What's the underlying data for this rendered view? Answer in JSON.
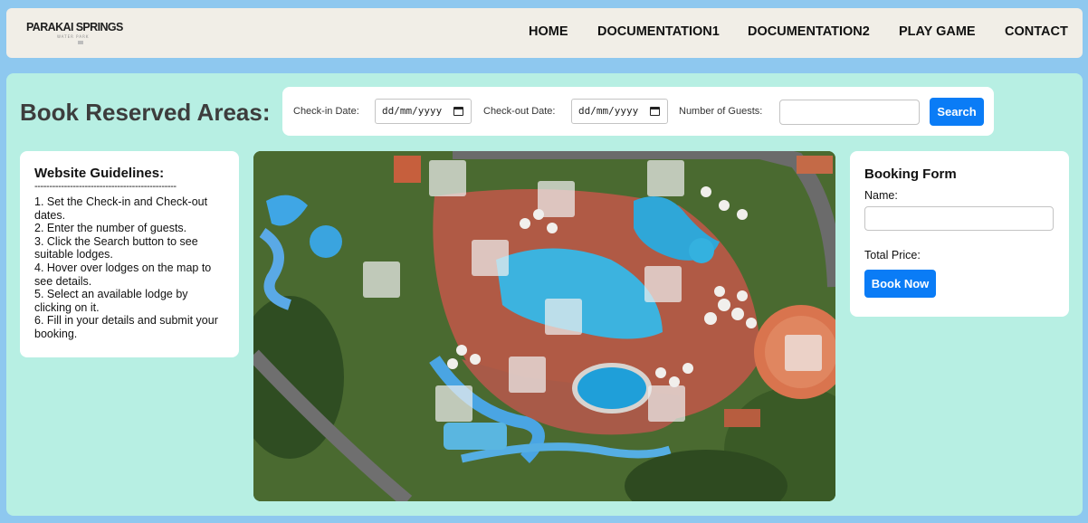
{
  "header": {
    "logo": {
      "name": "PARAKAI SPRINGS",
      "tagline": "WATER PARK"
    },
    "nav": [
      "HOME",
      "DOCUMENTATION1",
      "DOCUMENTATION2",
      "PLAY GAME",
      "CONTACT"
    ]
  },
  "page_title": "Book Reserved Areas:",
  "search": {
    "checkin_label": "Check-in Date:",
    "checkin_placeholder": "dd/mm/yyyy",
    "checkout_label": "Check-out Date:",
    "checkout_placeholder": "dd/mm/yyyy",
    "guests_label": "Number of Guests:",
    "guests_value": "",
    "button": "Search"
  },
  "guidelines": {
    "title": "Website Guidelines:",
    "rule": "------------------------------------------------",
    "steps": [
      "1. Set the Check-in and Check-out dates.",
      "2. Enter the number of guests.",
      "3. Click the Search button to see suitable lodges.",
      "4. Hover over lodges on the map to see details.",
      "5. Select an available lodge by clicking on it.",
      "6. Fill in your details and submit your booking."
    ]
  },
  "map": {
    "lodge_count": 14
  },
  "booking": {
    "title": "Booking Form",
    "name_label": "Name:",
    "name_value": "",
    "total_price_label": "Total Price:",
    "button": "Book Now"
  }
}
